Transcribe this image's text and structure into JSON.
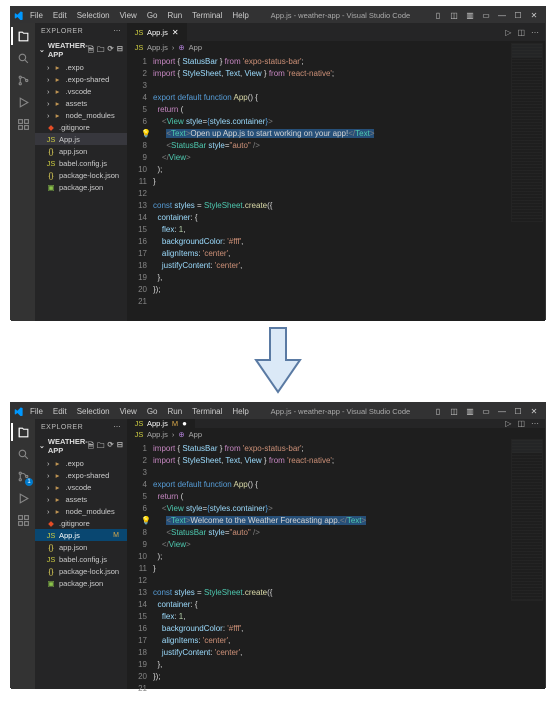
{
  "windows": [
    {
      "menus": [
        "File",
        "Edit",
        "Selection",
        "View",
        "Go",
        "Run",
        "Terminal",
        "Help"
      ],
      "title": "App.js - weather-app - Visual Studio Code",
      "explorer_label": "EXPLORER",
      "project": "WEATHER-APP",
      "tree": [
        {
          "name": ".expo",
          "kind": "folder",
          "exp": true
        },
        {
          "name": ".expo-shared",
          "kind": "folder",
          "exp": true
        },
        {
          "name": ".vscode",
          "kind": "folder",
          "exp": true
        },
        {
          "name": "assets",
          "kind": "folder",
          "exp": true
        },
        {
          "name": "node_modules",
          "kind": "folder",
          "exp": true
        },
        {
          "name": ".gitignore",
          "kind": "git"
        },
        {
          "name": "App.js",
          "kind": "js",
          "sel": true
        },
        {
          "name": "app.json",
          "kind": "json"
        },
        {
          "name": "babel.config.js",
          "kind": "js"
        },
        {
          "name": "package-lock.json",
          "kind": "json"
        },
        {
          "name": "package.json",
          "kind": "pkg"
        }
      ],
      "tab": {
        "name": "App.js",
        "modified": false
      },
      "breadcrumb": [
        "App.js",
        "App"
      ],
      "bulb_line": 7,
      "code": [
        [
          {
            "t": "import",
            "c": "k"
          },
          {
            "t": " { ",
            "c": ""
          },
          {
            "t": "StatusBar",
            "c": "c"
          },
          {
            "t": " } ",
            "c": ""
          },
          {
            "t": "from",
            "c": "k"
          },
          {
            "t": " ",
            "c": ""
          },
          {
            "t": "'expo-status-bar'",
            "c": "s"
          },
          {
            "t": ";",
            "c": ""
          }
        ],
        [
          {
            "t": "import",
            "c": "k"
          },
          {
            "t": " { ",
            "c": ""
          },
          {
            "t": "StyleSheet",
            "c": "c"
          },
          {
            "t": ", ",
            "c": ""
          },
          {
            "t": "Text",
            "c": "c"
          },
          {
            "t": ", ",
            "c": ""
          },
          {
            "t": "View",
            "c": "c"
          },
          {
            "t": " } ",
            "c": ""
          },
          {
            "t": "from",
            "c": "k"
          },
          {
            "t": " ",
            "c": ""
          },
          {
            "t": "'react-native'",
            "c": "s"
          },
          {
            "t": ";",
            "c": ""
          }
        ],
        [],
        [
          {
            "t": "export default function",
            "c": "b"
          },
          {
            "t": " ",
            "c": ""
          },
          {
            "t": "App",
            "c": "f"
          },
          {
            "t": "() {",
            "c": ""
          }
        ],
        [
          {
            "t": "  ",
            "c": ""
          },
          {
            "t": "return",
            "c": "k"
          },
          {
            "t": " (",
            "c": ""
          }
        ],
        [
          {
            "t": "    ",
            "c": ""
          },
          {
            "t": "<",
            "c": "p"
          },
          {
            "t": "View",
            "c": "t"
          },
          {
            "t": " ",
            "c": ""
          },
          {
            "t": "style",
            "c": "c"
          },
          {
            "t": "=",
            "c": ""
          },
          {
            "t": "{",
            "c": "b"
          },
          {
            "t": "styles.container",
            "c": "c"
          },
          {
            "t": "}",
            "c": "b"
          },
          {
            "t": ">",
            "c": "p"
          }
        ],
        [
          {
            "t": "      ",
            "c": ""
          },
          {
            "t": "<",
            "c": "p",
            "hl": true
          },
          {
            "t": "Text",
            "c": "t",
            "hl": true
          },
          {
            "t": ">",
            "c": "p",
            "hl": true
          },
          {
            "t": "Open up App.js to start working on your app!",
            "c": "",
            "hl": true
          },
          {
            "t": "</",
            "c": "p",
            "hl": true
          },
          {
            "t": "Text",
            "c": "t",
            "hl": true
          },
          {
            "t": ">",
            "c": "p",
            "hl": true
          }
        ],
        [
          {
            "t": "      ",
            "c": ""
          },
          {
            "t": "<",
            "c": "p"
          },
          {
            "t": "StatusBar",
            "c": "t"
          },
          {
            "t": " ",
            "c": ""
          },
          {
            "t": "style",
            "c": "c"
          },
          {
            "t": "=",
            "c": ""
          },
          {
            "t": "\"auto\"",
            "c": "s"
          },
          {
            "t": " />",
            "c": "p"
          }
        ],
        [
          {
            "t": "    ",
            "c": ""
          },
          {
            "t": "</",
            "c": "p"
          },
          {
            "t": "View",
            "c": "t"
          },
          {
            "t": ">",
            "c": "p"
          }
        ],
        [
          {
            "t": "  );",
            "c": ""
          }
        ],
        [
          {
            "t": "}",
            "c": ""
          }
        ],
        [],
        [
          {
            "t": "const",
            "c": "b"
          },
          {
            "t": " ",
            "c": ""
          },
          {
            "t": "styles",
            "c": "c"
          },
          {
            "t": " = ",
            "c": ""
          },
          {
            "t": "StyleSheet",
            "c": "t"
          },
          {
            "t": ".",
            "c": ""
          },
          {
            "t": "create",
            "c": "f"
          },
          {
            "t": "({",
            "c": ""
          }
        ],
        [
          {
            "t": "  ",
            "c": ""
          },
          {
            "t": "container",
            "c": "c"
          },
          {
            "t": ": {",
            "c": ""
          }
        ],
        [
          {
            "t": "    ",
            "c": ""
          },
          {
            "t": "flex",
            "c": "c"
          },
          {
            "t": ": ",
            "c": ""
          },
          {
            "t": "1",
            "c": "n"
          },
          {
            "t": ",",
            "c": ""
          }
        ],
        [
          {
            "t": "    ",
            "c": ""
          },
          {
            "t": "backgroundColor",
            "c": "c"
          },
          {
            "t": ": ",
            "c": ""
          },
          {
            "t": "'#fff'",
            "c": "s"
          },
          {
            "t": ",",
            "c": ""
          }
        ],
        [
          {
            "t": "    ",
            "c": ""
          },
          {
            "t": "alignItems",
            "c": "c"
          },
          {
            "t": ": ",
            "c": ""
          },
          {
            "t": "'center'",
            "c": "s"
          },
          {
            "t": ",",
            "c": ""
          }
        ],
        [
          {
            "t": "    ",
            "c": ""
          },
          {
            "t": "justifyContent",
            "c": "c"
          },
          {
            "t": ": ",
            "c": ""
          },
          {
            "t": "'center'",
            "c": "s"
          },
          {
            "t": ",",
            "c": ""
          }
        ],
        [
          {
            "t": "  },",
            "c": ""
          }
        ],
        [
          {
            "t": "});",
            "c": ""
          }
        ],
        []
      ]
    },
    {
      "menus": [
        "File",
        "Edit",
        "Selection",
        "View",
        "Go",
        "Run",
        "Terminal",
        "Help"
      ],
      "title": "App.js - weather-app - Visual Studio Code",
      "explorer_label": "EXPLORER",
      "project": "WEATHER-APP",
      "scm_badge": "1",
      "tree": [
        {
          "name": ".expo",
          "kind": "folder",
          "exp": true
        },
        {
          "name": ".expo-shared",
          "kind": "folder",
          "exp": true
        },
        {
          "name": ".vscode",
          "kind": "folder",
          "exp": true
        },
        {
          "name": "assets",
          "kind": "folder",
          "exp": true
        },
        {
          "name": "node_modules",
          "kind": "folder",
          "exp": true
        },
        {
          "name": ".gitignore",
          "kind": "git"
        },
        {
          "name": "App.js",
          "kind": "js",
          "sel": true,
          "mod": "M"
        },
        {
          "name": "app.json",
          "kind": "json"
        },
        {
          "name": "babel.config.js",
          "kind": "js"
        },
        {
          "name": "package-lock.json",
          "kind": "json"
        },
        {
          "name": "package.json",
          "kind": "pkg"
        }
      ],
      "tab": {
        "name": "App.js",
        "modified": true,
        "mod": "M"
      },
      "breadcrumb": [
        "App.js",
        "App"
      ],
      "bulb_line": 7,
      "code": [
        [
          {
            "t": "import",
            "c": "k"
          },
          {
            "t": " { ",
            "c": ""
          },
          {
            "t": "StatusBar",
            "c": "c"
          },
          {
            "t": " } ",
            "c": ""
          },
          {
            "t": "from",
            "c": "k"
          },
          {
            "t": " ",
            "c": ""
          },
          {
            "t": "'expo-status-bar'",
            "c": "s"
          },
          {
            "t": ";",
            "c": ""
          }
        ],
        [
          {
            "t": "import",
            "c": "k"
          },
          {
            "t": " { ",
            "c": ""
          },
          {
            "t": "StyleSheet",
            "c": "c"
          },
          {
            "t": ", ",
            "c": ""
          },
          {
            "t": "Text",
            "c": "c"
          },
          {
            "t": ", ",
            "c": ""
          },
          {
            "t": "View",
            "c": "c"
          },
          {
            "t": " } ",
            "c": ""
          },
          {
            "t": "from",
            "c": "k"
          },
          {
            "t": " ",
            "c": ""
          },
          {
            "t": "'react-native'",
            "c": "s"
          },
          {
            "t": ";",
            "c": ""
          }
        ],
        [],
        [
          {
            "t": "export default function",
            "c": "b"
          },
          {
            "t": " ",
            "c": ""
          },
          {
            "t": "App",
            "c": "f"
          },
          {
            "t": "() {",
            "c": ""
          }
        ],
        [
          {
            "t": "  ",
            "c": ""
          },
          {
            "t": "return",
            "c": "k"
          },
          {
            "t": " (",
            "c": ""
          }
        ],
        [
          {
            "t": "    ",
            "c": ""
          },
          {
            "t": "<",
            "c": "p"
          },
          {
            "t": "View",
            "c": "t"
          },
          {
            "t": " ",
            "c": ""
          },
          {
            "t": "style",
            "c": "c"
          },
          {
            "t": "=",
            "c": ""
          },
          {
            "t": "{",
            "c": "b"
          },
          {
            "t": "styles.container",
            "c": "c"
          },
          {
            "t": "}",
            "c": "b"
          },
          {
            "t": ">",
            "c": "p"
          }
        ],
        [
          {
            "t": "      ",
            "c": ""
          },
          {
            "t": "<",
            "c": "p",
            "hl": true
          },
          {
            "t": "Text",
            "c": "t",
            "hl": true
          },
          {
            "t": ">",
            "c": "p",
            "hl": true
          },
          {
            "t": "Welcome to the Weather Forecasting app.",
            "c": "",
            "hl": true
          },
          {
            "t": "</",
            "c": "p",
            "hl": true
          },
          {
            "t": "Text",
            "c": "t",
            "hl": true
          },
          {
            "t": ">",
            "c": "p",
            "hl": true
          }
        ],
        [
          {
            "t": "      ",
            "c": ""
          },
          {
            "t": "<",
            "c": "p"
          },
          {
            "t": "StatusBar",
            "c": "t"
          },
          {
            "t": " ",
            "c": ""
          },
          {
            "t": "style",
            "c": "c"
          },
          {
            "t": "=",
            "c": ""
          },
          {
            "t": "\"auto\"",
            "c": "s"
          },
          {
            "t": " />",
            "c": "p"
          }
        ],
        [
          {
            "t": "    ",
            "c": ""
          },
          {
            "t": "</",
            "c": "p"
          },
          {
            "t": "View",
            "c": "t"
          },
          {
            "t": ">",
            "c": "p"
          }
        ],
        [
          {
            "t": "  );",
            "c": ""
          }
        ],
        [
          {
            "t": "}",
            "c": ""
          }
        ],
        [],
        [
          {
            "t": "const",
            "c": "b"
          },
          {
            "t": " ",
            "c": ""
          },
          {
            "t": "styles",
            "c": "c"
          },
          {
            "t": " = ",
            "c": ""
          },
          {
            "t": "StyleSheet",
            "c": "t"
          },
          {
            "t": ".",
            "c": ""
          },
          {
            "t": "create",
            "c": "f"
          },
          {
            "t": "({",
            "c": ""
          }
        ],
        [
          {
            "t": "  ",
            "c": ""
          },
          {
            "t": "container",
            "c": "c"
          },
          {
            "t": ": {",
            "c": ""
          }
        ],
        [
          {
            "t": "    ",
            "c": ""
          },
          {
            "t": "flex",
            "c": "c"
          },
          {
            "t": ": ",
            "c": ""
          },
          {
            "t": "1",
            "c": "n"
          },
          {
            "t": ",",
            "c": ""
          }
        ],
        [
          {
            "t": "    ",
            "c": ""
          },
          {
            "t": "backgroundColor",
            "c": "c"
          },
          {
            "t": ": ",
            "c": ""
          },
          {
            "t": "'#fff'",
            "c": "s"
          },
          {
            "t": ",",
            "c": ""
          }
        ],
        [
          {
            "t": "    ",
            "c": ""
          },
          {
            "t": "alignItems",
            "c": "c"
          },
          {
            "t": ": ",
            "c": ""
          },
          {
            "t": "'center'",
            "c": "s"
          },
          {
            "t": ",",
            "c": ""
          }
        ],
        [
          {
            "t": "    ",
            "c": ""
          },
          {
            "t": "justifyContent",
            "c": "c"
          },
          {
            "t": ": ",
            "c": ""
          },
          {
            "t": "'center'",
            "c": "s"
          },
          {
            "t": ",",
            "c": ""
          }
        ],
        [
          {
            "t": "  },",
            "c": ""
          }
        ],
        [
          {
            "t": "});",
            "c": ""
          }
        ],
        []
      ]
    }
  ]
}
